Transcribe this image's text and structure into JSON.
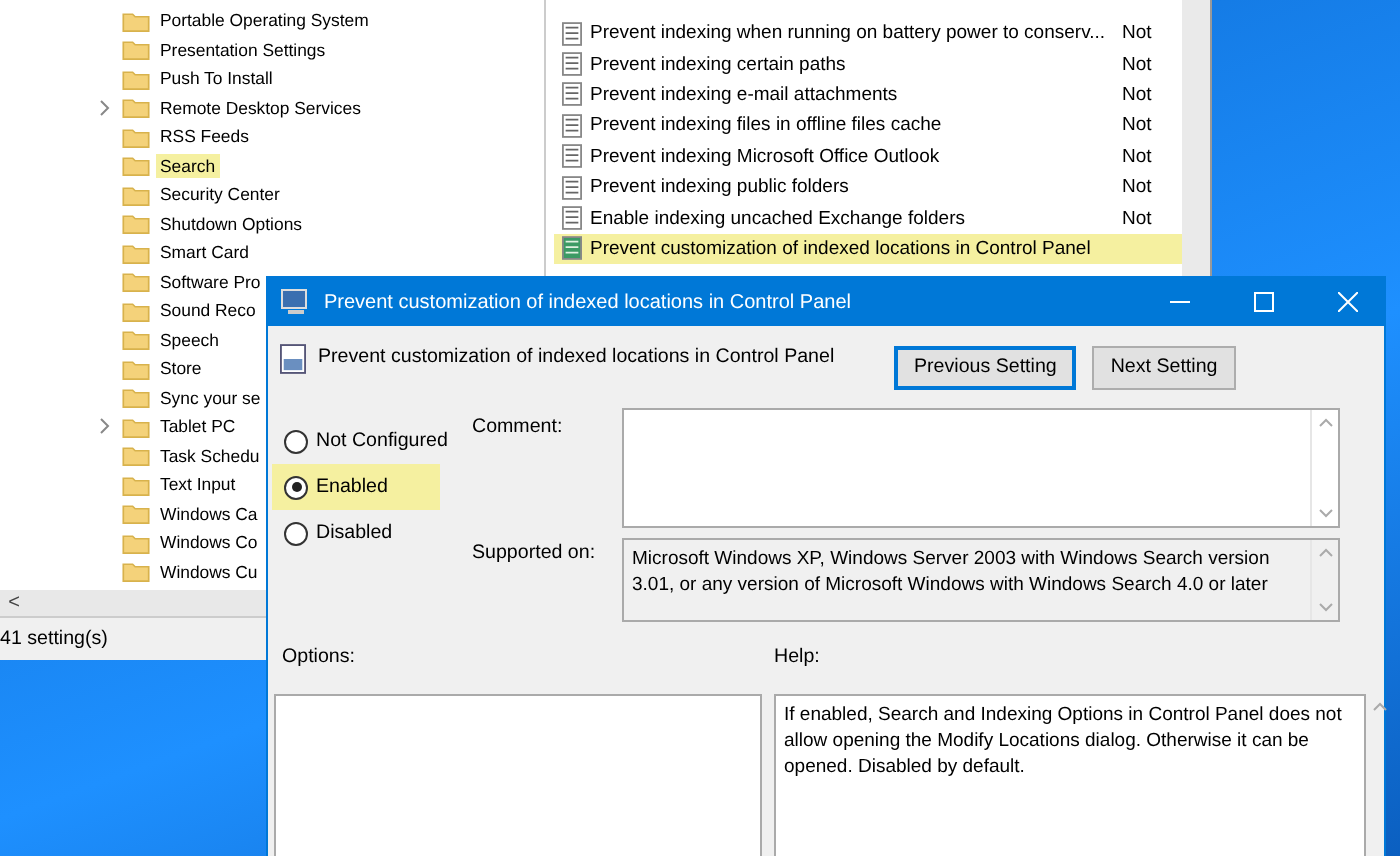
{
  "editor": {
    "tree_items": [
      {
        "label": "Portable Operating System",
        "expandable": false,
        "selected": false
      },
      {
        "label": "Presentation Settings",
        "expandable": false,
        "selected": false
      },
      {
        "label": "Push To Install",
        "expandable": false,
        "selected": false
      },
      {
        "label": "Remote Desktop Services",
        "expandable": true,
        "selected": false
      },
      {
        "label": "RSS Feeds",
        "expandable": false,
        "selected": false
      },
      {
        "label": "Search",
        "expandable": false,
        "selected": true
      },
      {
        "label": "Security Center",
        "expandable": false,
        "selected": false
      },
      {
        "label": "Shutdown Options",
        "expandable": false,
        "selected": false
      },
      {
        "label": "Smart Card",
        "expandable": false,
        "selected": false
      },
      {
        "label": "Software Pro",
        "expandable": false,
        "selected": false
      },
      {
        "label": "Sound Reco",
        "expandable": false,
        "selected": false
      },
      {
        "label": "Speech",
        "expandable": false,
        "selected": false
      },
      {
        "label": "Store",
        "expandable": false,
        "selected": false
      },
      {
        "label": "Sync your se",
        "expandable": false,
        "selected": false
      },
      {
        "label": "Tablet PC",
        "expandable": true,
        "selected": false
      },
      {
        "label": "Task Schedu",
        "expandable": false,
        "selected": false
      },
      {
        "label": "Text Input",
        "expandable": false,
        "selected": false
      },
      {
        "label": "Windows Ca",
        "expandable": false,
        "selected": false
      },
      {
        "label": "Windows Co",
        "expandable": false,
        "selected": false
      },
      {
        "label": "Windows Cu",
        "expandable": false,
        "selected": false
      }
    ],
    "settings": [
      {
        "name": "Prevent indexing when running on battery power to conserv...",
        "state": "Not",
        "selected": false
      },
      {
        "name": "Prevent indexing certain paths",
        "state": "Not",
        "selected": false
      },
      {
        "name": "Prevent indexing e-mail attachments",
        "state": "Not",
        "selected": false
      },
      {
        "name": "Prevent indexing files in offline files cache",
        "state": "Not",
        "selected": false
      },
      {
        "name": "Prevent indexing Microsoft Office Outlook",
        "state": "Not",
        "selected": false
      },
      {
        "name": "Prevent indexing public folders",
        "state": "Not",
        "selected": false
      },
      {
        "name": "Enable indexing uncached Exchange folders",
        "state": "Not",
        "selected": false
      },
      {
        "name": "Prevent customization of indexed locations in Control Panel",
        "selected": true
      }
    ],
    "scroll_left": "<",
    "status_bar": "41 setting(s)"
  },
  "dialog": {
    "title": "Prevent customization of indexed locations in Control Panel",
    "heading": "Prevent customization of indexed locations in Control Panel",
    "buttons": [
      {
        "label": "Previous Setting",
        "focused": true
      },
      {
        "label": "Next Setting",
        "focused": false
      }
    ],
    "options": [
      {
        "label": "Not Configured",
        "selected": false,
        "highlighted": false
      },
      {
        "label": "Enabled",
        "selected": true,
        "highlighted": true
      },
      {
        "label": "Disabled",
        "selected": false,
        "highlighted": false
      }
    ],
    "comment_label": "Comment:",
    "supported_label": "Supported on:",
    "supported_text": "Microsoft Windows XP, Windows Server 2003 with Windows Search version 3.01, or any version of Microsoft Windows with Windows Search 4.0 or later",
    "options_label": "Options:",
    "help_label": "Help:",
    "help_text": "If enabled, Search and Indexing Options in Control Panel does not allow opening the Modify Locations dialog. Otherwise it can be opened. Disabled by default."
  }
}
